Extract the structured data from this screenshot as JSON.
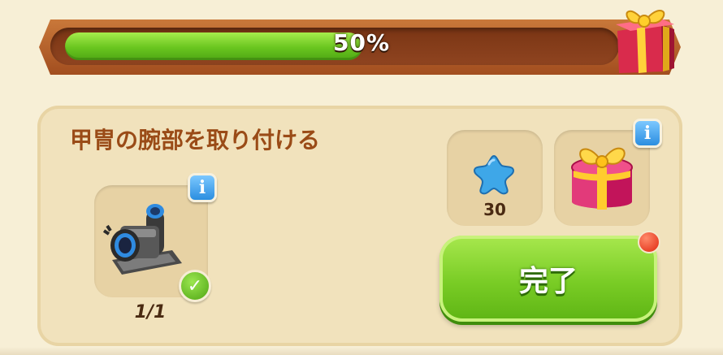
{
  "progress": {
    "fraction": 0.5,
    "label": "50%"
  },
  "task": {
    "title": "甲冑の腕部を取り付ける",
    "item": {
      "icon": "armor-arm-piece-icon",
      "count_text": "1/1",
      "completed": true
    },
    "rewards": [
      {
        "icon": "blue-star-icon",
        "amount": "30"
      },
      {
        "icon": "gift-box-icon"
      }
    ]
  },
  "info_symbol": "i",
  "check_symbol": "✓",
  "complete_button": {
    "label": "完了",
    "has_notification": true
  },
  "colors": {
    "progress_fill": "#6cc41f",
    "progress_track": "#8a3f1c",
    "title_text": "#9a4b17",
    "button_green": "#79cc25",
    "info_blue": "#2b8ee0",
    "notify_red": "#e02810"
  }
}
